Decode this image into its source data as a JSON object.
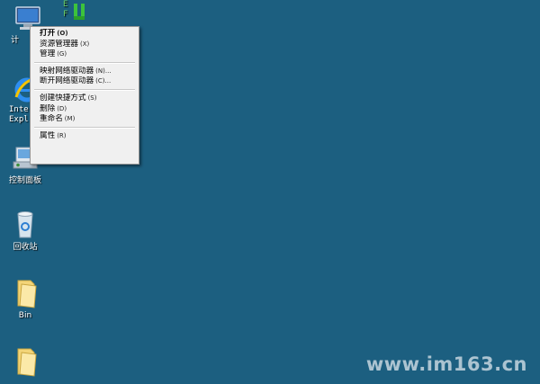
{
  "desktop": {
    "icons": [
      {
        "id": "computer",
        "label": "计算机"
      },
      {
        "id": "ie",
        "label": "Internet Explorer"
      },
      {
        "id": "control_panel",
        "label": "控制面板"
      },
      {
        "id": "recycle_bin",
        "label": "回收站"
      },
      {
        "id": "bin_folder",
        "label": "Bin"
      },
      {
        "id": "folder2",
        "label": ""
      }
    ],
    "partial_labels": {
      "computer_visible": "计",
      "ie_line1": "Inte",
      "ie_line2": "Expl",
      "top_icon_text": "E\nF"
    }
  },
  "context_menu": {
    "items": [
      {
        "label": "打开",
        "key": "(O)",
        "bold": true
      },
      {
        "label": "资源管理器",
        "key": "(X)"
      },
      {
        "label": "管理",
        "key": "(G)"
      },
      {
        "separator": true
      },
      {
        "label": "映射网络驱动器",
        "key": "(N)..."
      },
      {
        "label": "断开网络驱动器",
        "key": "(C)..."
      },
      {
        "separator": true
      },
      {
        "label": "创建快捷方式",
        "key": "(S)"
      },
      {
        "label": "删除",
        "key": "(D)"
      },
      {
        "label": "重命名",
        "key": "(M)"
      },
      {
        "separator": true
      },
      {
        "label": "属性",
        "key": "(R)"
      }
    ]
  },
  "watermark": "www.im163.cn",
  "colors": {
    "desktop": "#1c5f80",
    "menu_bg": "#f0f0f0"
  }
}
